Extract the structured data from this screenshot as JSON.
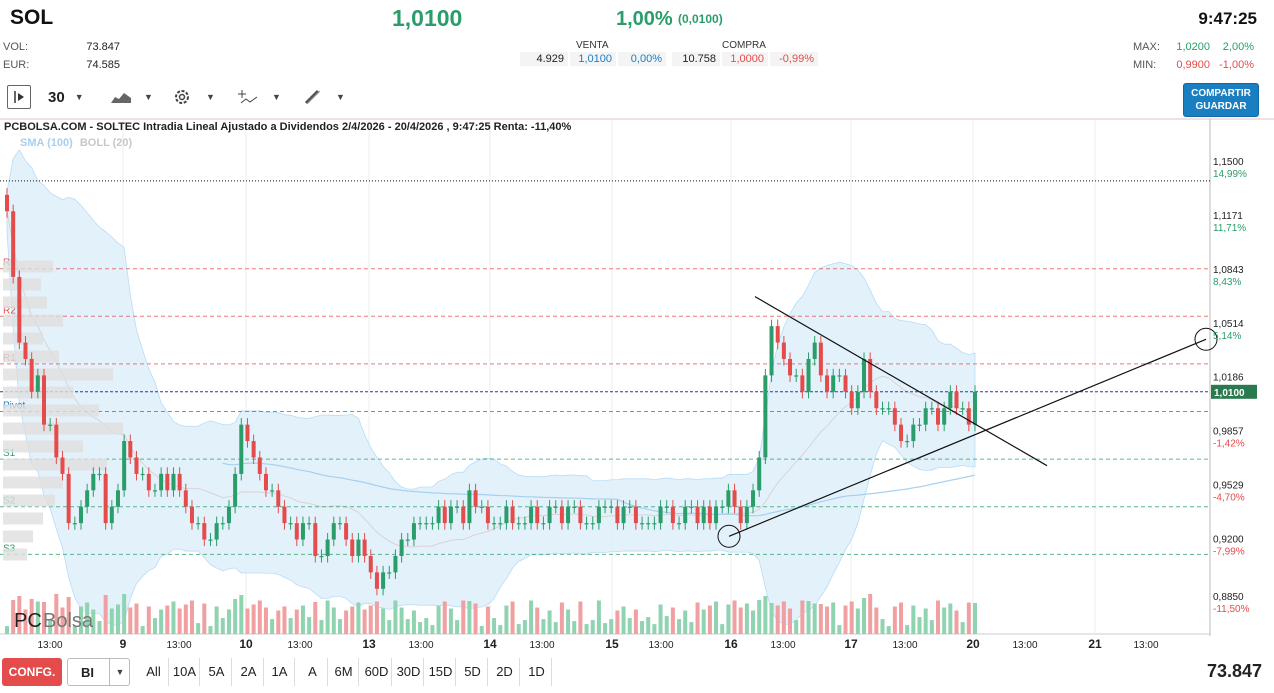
{
  "header": {
    "ticker": "SOL",
    "price": "1,0100",
    "change_pct": "1,00%",
    "change_abs": "(0,0100)",
    "time": "9:47:25"
  },
  "stats": {
    "vol_label": "VOL:",
    "vol_value": "73.847",
    "eur_label": "EUR:",
    "eur_value": "74.585"
  },
  "book": {
    "sell_label": "VENTA",
    "buy_label": "COMPRA",
    "sell_qty": "4.929",
    "sell_price": "1,0100",
    "sell_pct": "0,00%",
    "buy_qty": "10.758",
    "buy_price": "1,0000",
    "buy_pct": "-0,99%"
  },
  "minmax": {
    "max_label": "MAX:",
    "max_price": "1,0200",
    "max_pct": "2,00%",
    "min_label": "MIN:",
    "min_price": "0,9900",
    "min_pct": "-1,00%"
  },
  "toolbar": {
    "interval": "30",
    "share_label": "COMPARTIR",
    "save_label": "GUARDAR"
  },
  "chart": {
    "title": "PCBOLSA.COM - SOLTEC Intradia Lineal Ajustado a Dividendos 2/4/2026 - 20/4/2026 , 9:47:25 Renta: -11,40%",
    "legend_sma": "SMA (100)",
    "legend_boll": "BOLL (20)",
    "watermark_pc": "PC",
    "watermark_bolsa": "Bolsa",
    "current_price_tag": "1,0100"
  },
  "chart_data": {
    "type": "candlestick",
    "title": "PCBOLSA.COM - SOLTEC Intradia Lineal Ajustado a Dividendos 2/4/2026 - 20/4/2026 , 9:47:25 Renta: -11,40%",
    "y_axis": [
      {
        "price": 1.15,
        "label": "1,1500",
        "pct": "14,99%"
      },
      {
        "price": 1.1171,
        "label": "1,1171",
        "pct": "11,71%"
      },
      {
        "price": 1.0843,
        "label": "1,0843",
        "pct": "8,43%"
      },
      {
        "price": 1.0514,
        "label": "1,0514",
        "pct": "5,14%"
      },
      {
        "price": 1.0186,
        "label": "1,0186",
        "pct": "1,86%"
      },
      {
        "price": 0.9857,
        "label": "0,9857",
        "pct": "-1,42%"
      },
      {
        "price": 0.9529,
        "label": "0,9529",
        "pct": "-4,70%"
      },
      {
        "price": 0.92,
        "label": "0,9200",
        "pct": "-7,99%"
      },
      {
        "price": 0.885,
        "label": "0,8850",
        "pct": "-11,50%"
      }
    ],
    "ylim": [
      0.885,
      1.15
    ],
    "x_labels": [
      "13:00",
      "9",
      "13:00",
      "10",
      "13:00",
      "13",
      "13:00",
      "14",
      "13:00",
      "15",
      "13:00",
      "16",
      "13:00",
      "17",
      "13:00",
      "20",
      "13:00",
      "21",
      "13:00"
    ],
    "pivots": [
      {
        "name": "R3",
        "value": 1.085
      },
      {
        "name": "R2",
        "value": 1.056
      },
      {
        "name": "R1",
        "value": 1.027
      },
      {
        "name": "Pivot",
        "value": 0.998
      },
      {
        "name": "S1",
        "value": 0.969
      },
      {
        "name": "S2",
        "value": 0.94
      },
      {
        "name": "S3",
        "value": 0.911
      }
    ],
    "last_price": 1.01,
    "max_line": 1.1385,
    "closes": [
      1.12,
      1.08,
      1.04,
      1.03,
      1.01,
      1.02,
      0.99,
      0.99,
      0.97,
      0.96,
      0.93,
      0.93,
      0.94,
      0.95,
      0.96,
      0.96,
      0.93,
      0.94,
      0.95,
      0.98,
      0.97,
      0.96,
      0.96,
      0.95,
      0.95,
      0.96,
      0.95,
      0.96,
      0.95,
      0.94,
      0.93,
      0.93,
      0.92,
      0.92,
      0.93,
      0.93,
      0.94,
      0.96,
      0.99,
      0.98,
      0.97,
      0.96,
      0.95,
      0.95,
      0.94,
      0.93,
      0.93,
      0.92,
      0.93,
      0.93,
      0.91,
      0.91,
      0.92,
      0.93,
      0.93,
      0.92,
      0.91,
      0.92,
      0.91,
      0.9,
      0.89,
      0.9,
      0.9,
      0.91,
      0.92,
      0.92,
      0.93,
      0.93,
      0.93,
      0.93,
      0.94,
      0.93,
      0.94,
      0.94,
      0.93,
      0.95,
      0.94,
      0.94,
      0.93,
      0.93,
      0.93,
      0.94,
      0.93,
      0.93,
      0.93,
      0.94,
      0.93,
      0.93,
      0.94,
      0.94,
      0.93,
      0.94,
      0.94,
      0.93,
      0.93,
      0.93,
      0.94,
      0.94,
      0.94,
      0.93,
      0.94,
      0.94,
      0.93,
      0.93,
      0.93,
      0.93,
      0.94,
      0.94,
      0.93,
      0.93,
      0.94,
      0.94,
      0.93,
      0.94,
      0.93,
      0.94,
      0.94,
      0.95,
      0.94,
      0.93,
      0.94,
      0.95,
      0.97,
      1.02,
      1.05,
      1.04,
      1.03,
      1.02,
      1.02,
      1.01,
      1.03,
      1.04,
      1.02,
      1.01,
      1.02,
      1.02,
      1.01,
      1.0,
      1.01,
      1.03,
      1.01,
      1.0,
      1.0,
      1.0,
      0.99,
      0.98,
      0.98,
      0.99,
      0.99,
      1.0,
      1.0,
      0.99,
      1.0,
      1.01,
      1.0,
      1.0,
      0.99,
      1.01
    ]
  },
  "footer": {
    "conf_label": "CONFG.",
    "select_value": "BI",
    "ranges": [
      "All",
      "10A",
      "5A",
      "2A",
      "1A",
      "A",
      "6M",
      "60D",
      "30D",
      "15D",
      "5D",
      "2D",
      "1D"
    ],
    "volume": "73.847"
  },
  "colors": {
    "up": "#2a9d6a",
    "down": "#e44c4c",
    "accent": "#1a7fc1",
    "boll_fill": "#dcedfa",
    "sma": "#a6d0ef"
  }
}
